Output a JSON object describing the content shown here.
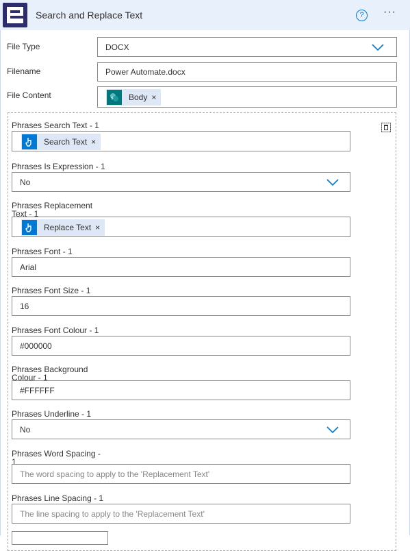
{
  "header": {
    "title": "Search and Replace Text",
    "help": "?",
    "more": "···"
  },
  "fields": {
    "file_type": {
      "label": "File Type",
      "value": "DOCX"
    },
    "filename": {
      "label": "Filename",
      "value": "Power Automate.docx"
    },
    "file_content": {
      "label": "File Content",
      "token": "Body"
    }
  },
  "phrases": {
    "search_text": {
      "label": "Phrases Search Text - 1",
      "token": "Search Text"
    },
    "is_expression": {
      "label": "Phrases Is Expression - 1",
      "value": "No"
    },
    "replacement_text": {
      "label_line1": "Phrases Replacement",
      "label_line2": "Text - 1",
      "token": "Replace Text"
    },
    "font": {
      "label": "Phrases Font - 1",
      "value": "Arial"
    },
    "font_size": {
      "label": "Phrases Font Size - 1",
      "value": "16"
    },
    "font_colour": {
      "label": "Phrases Font Colour - 1",
      "value": "#000000"
    },
    "background_colour": {
      "label_line1": "Phrases Background",
      "label_line2": "Colour - 1",
      "value": "#FFFFFF"
    },
    "underline": {
      "label": "Phrases Underline - 1",
      "value": "No"
    },
    "word_spacing": {
      "label_line1": "Phrases Word Spacing -",
      "label_line2": "1",
      "placeholder": "The word spacing to apply to the 'Replacement Text'"
    },
    "line_spacing": {
      "label": "Phrases Line Spacing - 1",
      "placeholder": "The line spacing to apply to the 'Replacement Text'"
    }
  },
  "token_close": "×",
  "colors": {
    "accent": "#0078d4",
    "header_bg": "#e8f0fc",
    "token_bg": "#dde7f5",
    "logo_bg": "#2d2d6e",
    "sharepoint": "#03787c"
  }
}
